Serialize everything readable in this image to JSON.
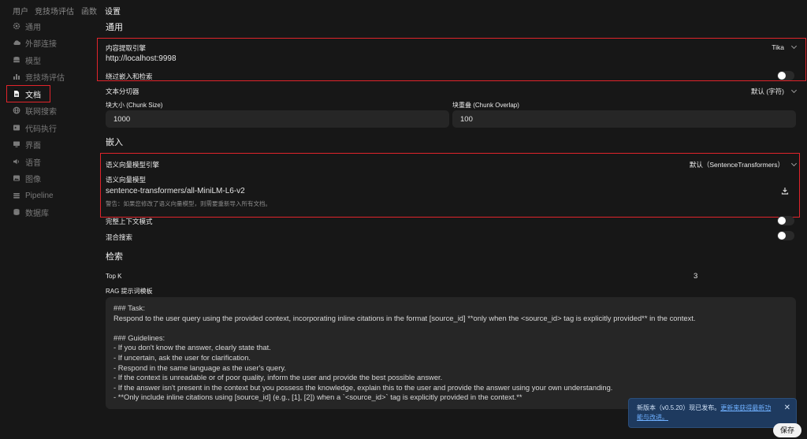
{
  "top_tabs": [
    "用户",
    "竞技场评估",
    "函数",
    "设置"
  ],
  "sidebar": {
    "items": [
      {
        "label": "通用",
        "icon": "gear-icon"
      },
      {
        "label": "外部连接",
        "icon": "cloud-icon"
      },
      {
        "label": "模型",
        "icon": "stack-icon"
      },
      {
        "label": "竞技场评估",
        "icon": "chart-icon"
      },
      {
        "label": "文档",
        "icon": "document-icon"
      },
      {
        "label": "联网搜索",
        "icon": "globe-icon"
      },
      {
        "label": "代码执行",
        "icon": "terminal-icon"
      },
      {
        "label": "界面",
        "icon": "monitor-icon"
      },
      {
        "label": "语音",
        "icon": "speaker-icon"
      },
      {
        "label": "图像",
        "icon": "image-icon"
      },
      {
        "label": "Pipeline",
        "icon": "pipeline-icon"
      },
      {
        "label": "数据库",
        "icon": "database-icon"
      }
    ]
  },
  "general": {
    "title": "通用",
    "content_engine_label": "内容提取引擎",
    "content_engine_value": "Tika",
    "tika_url": "http://localhost:9998",
    "bypass_label": "绕过嵌入和检索",
    "splitter_label": "文本分切器",
    "splitter_value": "默认 (字符)",
    "chunk_size_label": "块大小 (Chunk Size)",
    "chunk_size_value": "1000",
    "chunk_overlap_label": "块重叠 (Chunk Overlap)",
    "chunk_overlap_value": "100"
  },
  "embedding": {
    "title": "嵌入",
    "engine_label": "语义向量模型引擎",
    "engine_value": "默认（SentenceTransformers）",
    "model_label": "语义向量模型",
    "model_value": "sentence-transformers/all-MiniLM-L6-v2",
    "warning": "警告：如果您修改了语义向量模型，则需要重新导入所有文档。",
    "full_context_label": "完整上下文模式",
    "hybrid_label": "混合搜索"
  },
  "retrieval": {
    "title": "检索",
    "topk_label": "Top K",
    "topk_value": "3",
    "rag_label": "RAG 提示词模板",
    "rag_lines": [
      "### Task:",
      "Respond to the user query using the provided context, incorporating inline citations in the format [source_id] **only when the <source_id> tag is explicitly provided** in the context.",
      "",
      "### Guidelines:",
      "- If you don't know the answer, clearly state that.",
      "- If uncertain, ask the user for clarification.",
      "- Respond in the same language as the user's query.",
      "- If the context is unreadable or of poor quality, inform the user and provide the best possible answer.",
      "- If the answer isn't present in the context but you possess the knowledge, explain this to the user and provide the answer using your own understanding.",
      "- **Only include inline citations using [source_id] (e.g., [1], [2]) when a `<source_id>` tag is explicitly provided in the context.**"
    ]
  },
  "toast": {
    "text": "新版本（v0.5.20）现已发布。",
    "link": "更新来获得最新功能与改进。",
    "close": "✕"
  },
  "save_label": "保存",
  "colors": {
    "background": "#171717",
    "input": "#262626",
    "highlight": "#e0242b",
    "toast": "#1e3a5f"
  }
}
